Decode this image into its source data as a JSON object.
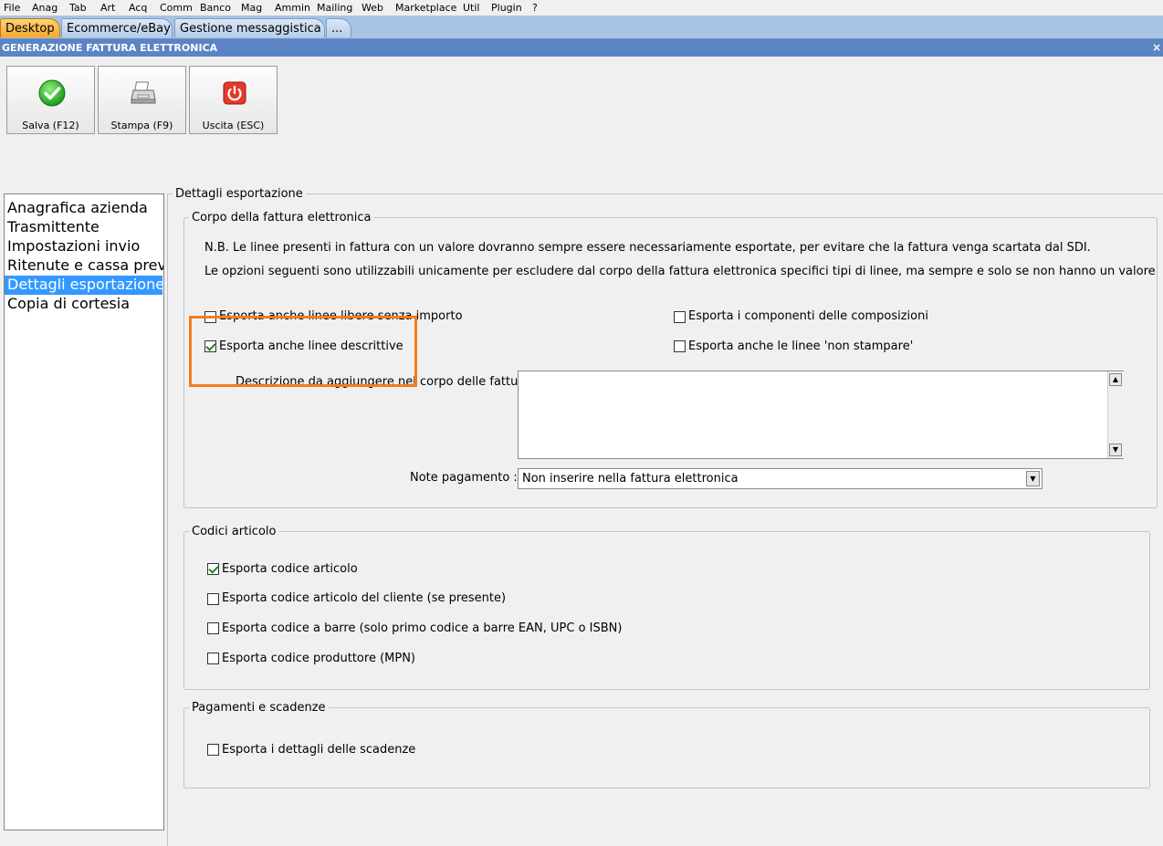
{
  "menu": [
    "File",
    "Anag",
    "Tab",
    "Art",
    "Acq",
    "Comm",
    "Banco",
    "Mag",
    "Ammin",
    "Mailing",
    "Web",
    "Marketplace",
    "Util",
    "Plugin",
    "?"
  ],
  "tabs": [
    "Desktop",
    "Ecommerce/eBay",
    "Gestione messaggistica",
    "..."
  ],
  "window": {
    "title": "GENERAZIONE FATTURA ELETTRONICA",
    "close": "×"
  },
  "toolbar": {
    "save": "Salva (F12)",
    "print": "Stampa (F9)",
    "exit": "Uscita (ESC)"
  },
  "sidebar": {
    "items": [
      "Anagrafica azienda",
      "Trasmittente",
      "Impostazioni invio",
      "Ritenute e cassa previdenziale",
      "Dettagli esportazione",
      "Copia di cortesia"
    ],
    "selected_index": 4
  },
  "main": {
    "outer_label": "Dettagli esportazione",
    "corpo": {
      "label": "Corpo della fattura elettronica",
      "note1": "N.B. Le linee presenti in fattura con un valore dovranno sempre essere necessariamente esportate, per evitare che la fattura venga scartata dal SDI.",
      "note2": "Le opzioni seguenti sono utilizzabili unicamente per escludere dal corpo della fattura elettronica specifici tipi di linee, ma sempre e solo se non hanno un valore",
      "cb_libere": {
        "label": "Esporta anche linee libere senza importo",
        "checked": false
      },
      "cb_descrittive": {
        "label": "Esporta anche linee descrittive",
        "checked": true
      },
      "cb_componenti": {
        "label": "Esporta i componenti delle composizioni",
        "checked": false
      },
      "cb_non_stampare": {
        "label": "Esporta anche le linee 'non stampare'",
        "checked": false
      },
      "descrizione_label": "Descrizione da aggiungere nel corpo delle fatture :",
      "descrizione_value": "",
      "note_pagamento_label": "Note pagamento :",
      "note_pagamento_value": "Non inserire nella fattura elettronica"
    },
    "codici": {
      "label": "Codici articolo",
      "items": [
        {
          "label": "Esporta codice articolo",
          "checked": true
        },
        {
          "label": "Esporta codice articolo del cliente (se presente)",
          "checked": false
        },
        {
          "label": "Esporta codice a barre (solo primo codice a barre EAN, UPC o ISBN)",
          "checked": false
        },
        {
          "label": "Esporta codice produttore (MPN)",
          "checked": false
        }
      ]
    },
    "pagamenti": {
      "label": "Pagamenti e scadenze",
      "items": [
        {
          "label": "Esporta i dettagli delle scadenze",
          "checked": false
        }
      ]
    }
  },
  "colors": {
    "accent": "#3399ff",
    "highlight": "#f47c20",
    "title_bar": "#5b84c4",
    "tab_active": "#f4a82a"
  }
}
